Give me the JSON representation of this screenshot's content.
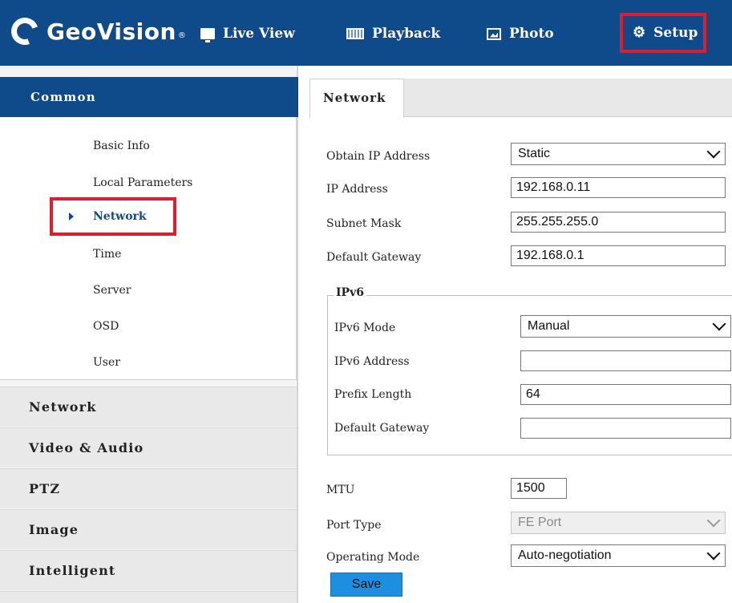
{
  "header": {
    "brand": "GeoVision",
    "brand_mark": "®",
    "nav": [
      {
        "label": "Live View",
        "icon": "monitor-icon"
      },
      {
        "label": "Playback",
        "icon": "film-icon"
      },
      {
        "label": "Photo",
        "icon": "photo-icon"
      },
      {
        "label": "Setup",
        "icon": "gear-icon"
      }
    ],
    "colors": {
      "bar": "#0f4a8a",
      "highlight": "#e11d2b"
    }
  },
  "sidebar": {
    "active_category": "Common",
    "sub_items": [
      "Basic Info",
      "Local Parameters",
      "Network",
      "Time",
      "Server",
      "OSD",
      "User"
    ],
    "active_sub_item": "Network",
    "categories": [
      "Network",
      "Video & Audio",
      "PTZ",
      "Image",
      "Intelligent"
    ]
  },
  "content": {
    "tab": "Network",
    "ipv4": {
      "obtain_label": "Obtain IP Address",
      "obtain_value": "Static",
      "ip_label": "IP Address",
      "ip_value": "192.168.0.11",
      "mask_label": "Subnet Mask",
      "mask_value": "255.255.255.0",
      "gateway_label": "Default Gateway",
      "gateway_value": "192.168.0.1"
    },
    "ipv6": {
      "legend": "IPv6",
      "mode_label": "IPv6 Mode",
      "mode_value": "Manual",
      "address_label": "IPv6 Address",
      "address_value": "",
      "prefix_label": "Prefix Length",
      "prefix_value": "64",
      "gateway_label": "Default Gateway",
      "gateway_value": ""
    },
    "mtu_label": "MTU",
    "mtu_value": "1500",
    "port_type_label": "Port Type",
    "port_type_value": "FE Port",
    "operating_mode_label": "Operating Mode",
    "operating_mode_value": "Auto-negotiation",
    "save_label": "Save"
  }
}
